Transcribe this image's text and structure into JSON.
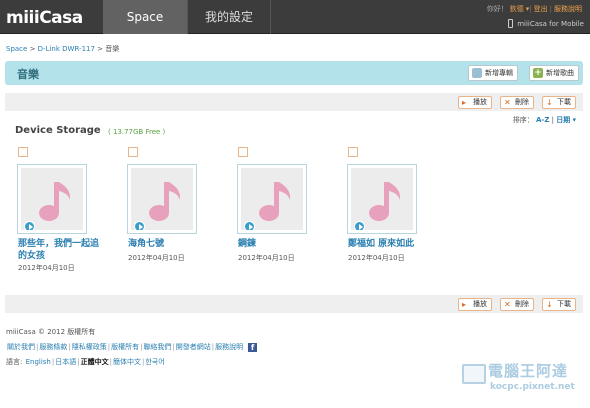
{
  "logo": {
    "text": "miiiCasa"
  },
  "nav": {
    "space": "Space",
    "settings": "我的設定"
  },
  "toplinks": {
    "hello": "你好！",
    "user": "欽德",
    "logout": "登出",
    "help": "服務說明"
  },
  "mobile_label": "miiiCasa for Mobile",
  "breadcrumb": {
    "root": "Space",
    "device": "D-Link DWR-117",
    "current": "音樂"
  },
  "header": {
    "title": "音樂",
    "new_album": "新增專輯",
    "new_song": "新增歌曲"
  },
  "actions": {
    "play": "播放",
    "delete": "刪除",
    "download": "下載"
  },
  "sort": {
    "label": "排序：",
    "az": "A-Z",
    "sep": "|",
    "date": "日期"
  },
  "storage": {
    "title": "Device Storage",
    "free": "( 13.77GB Free )"
  },
  "items": [
    {
      "title": "那些年，我們一起追的女孩",
      "date": "2012年04月10日"
    },
    {
      "title": "海角七號",
      "date": "2012年04月10日"
    },
    {
      "title": "鋼鍊",
      "date": "2012年04月10日"
    },
    {
      "title": "鄭福如 原來如此",
      "date": "2012年04月10日"
    }
  ],
  "footer": {
    "copyright": "miiiCasa © 2012   版權所有",
    "links": [
      "關於我們",
      "服務條款",
      "隱私權政策",
      "版權所有",
      "聯絡我們",
      "開發者網站",
      "服務說明"
    ],
    "lang_label": "語言:",
    "langs": [
      "English",
      "日本語",
      "正體中文",
      "簡体中文",
      "한국어"
    ]
  },
  "watermark": {
    "line1": "電腦王阿達",
    "line2": "kocpc.pixnet.net"
  },
  "colors": {
    "topbar": "#3c3c3c",
    "header_bar": "#b3e2ea",
    "accent_orange": "#e06a28",
    "link_blue": "#2a7fb0",
    "note_pink": "#e7a1bc"
  },
  "icons": {
    "play_action": "play-icon",
    "delete_action": "x-icon",
    "download_action": "download-arrow-icon",
    "music": "music-note-icon",
    "facebook": "facebook-icon"
  }
}
